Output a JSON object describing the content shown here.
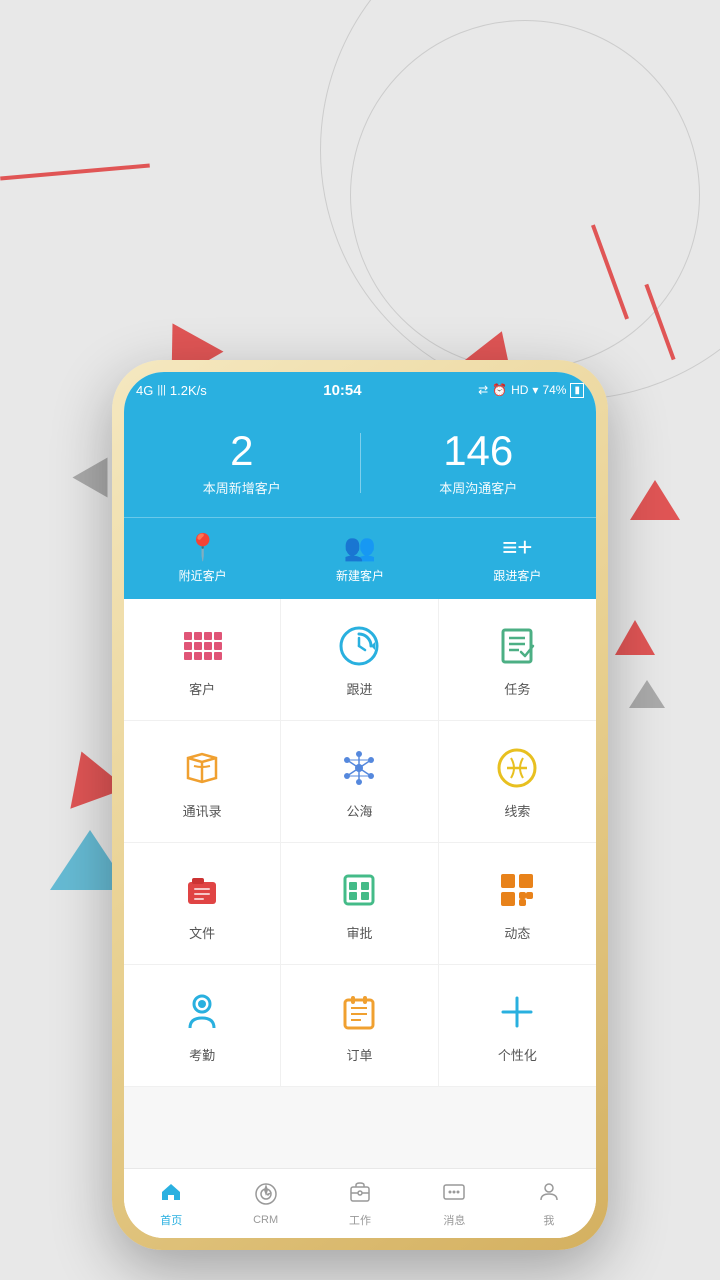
{
  "background": {
    "color": "#e8e8e8"
  },
  "statusBar": {
    "signal": "4G",
    "bars": "|||",
    "speed": "1.2K/s",
    "time": "10:54",
    "battery": "74%",
    "wifi": "HD"
  },
  "header": {
    "stat1": {
      "number": "2",
      "label": "本周新增客户"
    },
    "stat2": {
      "number": "146",
      "label": "本周沟通客户"
    },
    "quickActions": [
      {
        "id": "nearby",
        "label": "附近客户"
      },
      {
        "id": "new",
        "label": "新建客户"
      },
      {
        "id": "follow",
        "label": "跟进客户"
      }
    ]
  },
  "menu": {
    "items": [
      {
        "id": "customer",
        "label": "客户",
        "color": "#e05577"
      },
      {
        "id": "followup",
        "label": "跟进",
        "color": "#29b0df"
      },
      {
        "id": "task",
        "label": "任务",
        "color": "#4caf84"
      },
      {
        "id": "contacts",
        "label": "通讯录",
        "color": "#f0a030"
      },
      {
        "id": "public",
        "label": "公海",
        "color": "#5588dd"
      },
      {
        "id": "leads",
        "label": "线索",
        "color": "#e8c020"
      },
      {
        "id": "files",
        "label": "文件",
        "color": "#e04444"
      },
      {
        "id": "approval",
        "label": "审批",
        "color": "#44bb88"
      },
      {
        "id": "dynamic",
        "label": "动态",
        "color": "#e8821a"
      },
      {
        "id": "attendance",
        "label": "考勤",
        "color": "#29b0df"
      },
      {
        "id": "order",
        "label": "订单",
        "color": "#f0a030"
      },
      {
        "id": "customize",
        "label": "个性化",
        "color": "#29b0df"
      }
    ]
  },
  "bottomNav": {
    "items": [
      {
        "id": "home",
        "label": "首页",
        "active": true
      },
      {
        "id": "crm",
        "label": "CRM",
        "active": false
      },
      {
        "id": "work",
        "label": "工作",
        "active": false
      },
      {
        "id": "message",
        "label": "消息",
        "active": false
      },
      {
        "id": "me",
        "label": "我",
        "active": false
      }
    ]
  }
}
